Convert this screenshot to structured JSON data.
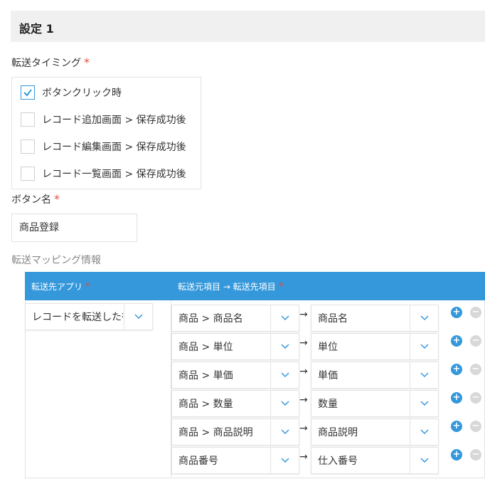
{
  "section": {
    "title": "設定 1"
  },
  "transfer_timing": {
    "label": "転送タイミング",
    "required_mark": "*",
    "options": [
      {
        "label": "ボタンクリック時",
        "checked": true
      },
      {
        "label": "レコード追加画面 > 保存成功後",
        "checked": false
      },
      {
        "label": "レコード編集画面 > 保存成功後",
        "checked": false
      },
      {
        "label": "レコード一覧画面 > 保存成功後",
        "checked": false
      }
    ]
  },
  "button_name": {
    "label": "ボタン名",
    "required_mark": "*",
    "value": "商品登録"
  },
  "mapping": {
    "label": "転送マッピング情報",
    "headers": {
      "dest_app": "転送先アプリ",
      "fields": "転送元項目 → 転送先項目",
      "required_mark": "*"
    },
    "dest_app_value": "レコードを転送した行",
    "arrow": "→",
    "rows": [
      {
        "source": "商品 > 商品名",
        "target": "商品名"
      },
      {
        "source": "商品 > 単位",
        "target": "単位"
      },
      {
        "source": "商品 > 単価",
        "target": "単価"
      },
      {
        "source": "商品 > 数量",
        "target": "数量"
      },
      {
        "source": "商品 > 商品説明",
        "target": "商品説明"
      },
      {
        "source": "商品番号",
        "target": "仕入番号"
      }
    ],
    "add_symbol": "+",
    "remove_symbol": "−"
  },
  "colors": {
    "accent": "#3498db",
    "required": "#e74c3c",
    "header_bg": "#f0f0f0",
    "border": "#e3e3e3"
  }
}
